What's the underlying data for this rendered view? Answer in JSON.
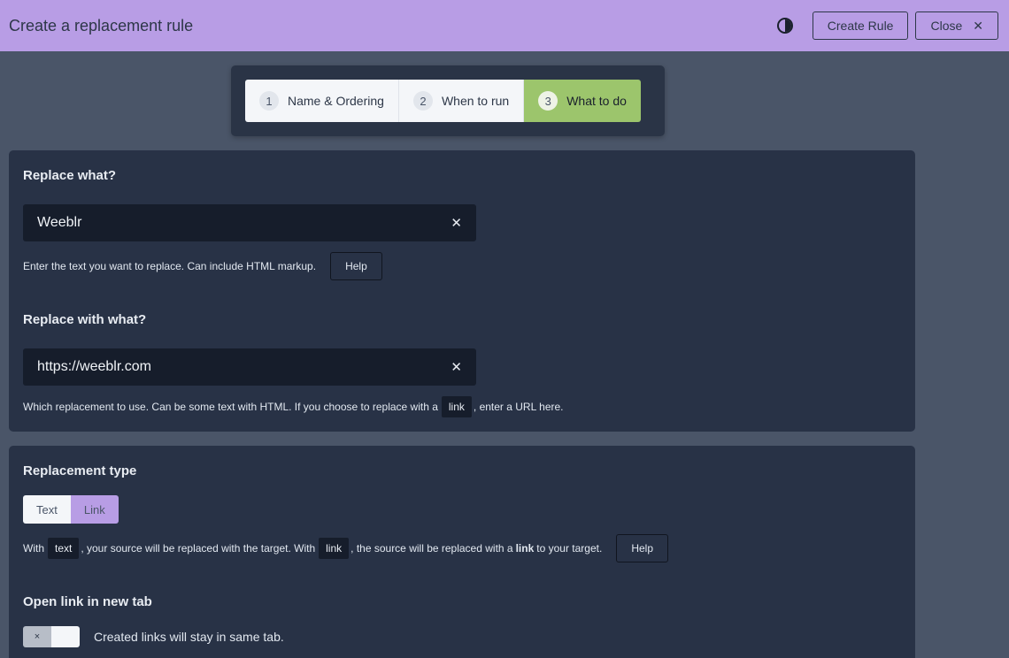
{
  "header": {
    "title": "Create a replacement rule",
    "create_rule_label": "Create Rule",
    "close_label": "Close",
    "close_glyph": "✕",
    "theme_icon": "contrast-icon"
  },
  "stepper": {
    "steps": [
      {
        "num": "1",
        "label": "Name & Ordering"
      },
      {
        "num": "2",
        "label": "When to run"
      },
      {
        "num": "3",
        "label": "What to do"
      }
    ],
    "active_step": 3
  },
  "replace_what": {
    "heading": "Replace what?",
    "value": "Weeblr",
    "clear_glyph": "✕",
    "hint": "Enter the text you want to replace. Can include HTML markup.",
    "help_label": "Help"
  },
  "replace_with": {
    "heading": "Replace with what?",
    "value": "https://weeblr.com",
    "clear_glyph": "✕",
    "hint_before": "Which replacement to use. Can be some text with HTML. If you choose to replace with a",
    "hint_code": "link",
    "hint_after": ", enter a URL here."
  },
  "replacement_type": {
    "heading": "Replacement type",
    "options": [
      "Text",
      "Link"
    ],
    "selected": "Link",
    "hint_with": "With",
    "hint_code_text": "text",
    "hint_mid": ", your source will be replaced with the target. With",
    "hint_code_link": "link",
    "hint_mid2": ", the source will be replaced with a",
    "hint_bold": "link",
    "hint_end": "to your target.",
    "help_label": "Help"
  },
  "open_new_tab": {
    "heading": "Open link in new tab",
    "toggle_glyph": "×",
    "toggle_state": "off",
    "description": "Created links will stay in same tab."
  },
  "colors": {
    "header_bg": "#b89de5",
    "page_bg": "#4a5568",
    "card_bg": "#283246",
    "active_step_bg": "#9cc56c"
  }
}
